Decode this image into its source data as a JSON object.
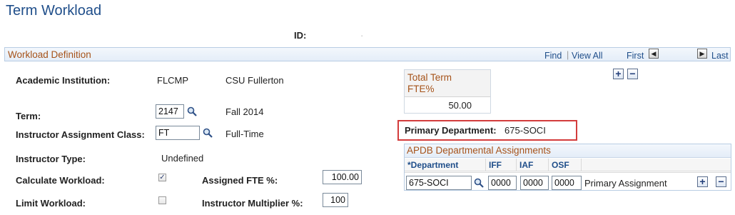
{
  "page": {
    "title": "Term Workload",
    "id_label": "ID:",
    "id_value": "·"
  },
  "bar": {
    "title": "Workload Definition",
    "find": "Find",
    "view_all": "View All",
    "first": "First",
    "last": "Last"
  },
  "fields": {
    "institution": {
      "label": "Academic Institution:",
      "code": "FLCMP",
      "desc": "CSU Fullerton"
    },
    "term": {
      "label": "Term:",
      "value": "2147",
      "desc": "Fall 2014"
    },
    "assign_class": {
      "label": "Instructor Assignment Class:",
      "value": "FT",
      "desc": "Full-Time"
    },
    "instr_type": {
      "label": "Instructor Type:",
      "value": "Undefined"
    },
    "calc_workload": {
      "label": "Calculate Workload:",
      "checked": true,
      "check_mark": "✓"
    },
    "limit_workload": {
      "label": "Limit Workload:",
      "checked": false
    },
    "assigned_fte": {
      "label": "Assigned FTE %:",
      "value": "100.00"
    },
    "instr_mult": {
      "label": "Instructor Multiplier %:",
      "value": "100"
    }
  },
  "fte_box": {
    "title": "Total Term FTE%",
    "value": "50.00"
  },
  "primary_dept": {
    "label": "Primary Department:",
    "value": "675-SOCI"
  },
  "apdb": {
    "title": "APDB Departmental Assignments",
    "columns": [
      "*Department",
      "IFF",
      "IAF",
      "OSF"
    ],
    "rows": [
      {
        "department": "675-SOCI",
        "iff": "0000",
        "iaf": "0000",
        "osf": "0000",
        "desc": "Primary Assignment"
      }
    ]
  },
  "buttons": {
    "add": "+",
    "remove": "−",
    "prev": "◀",
    "next": "▶"
  },
  "colors": {
    "title": "#1f4e8a",
    "section": "#a6531a",
    "highlight": "#d33c3c"
  }
}
